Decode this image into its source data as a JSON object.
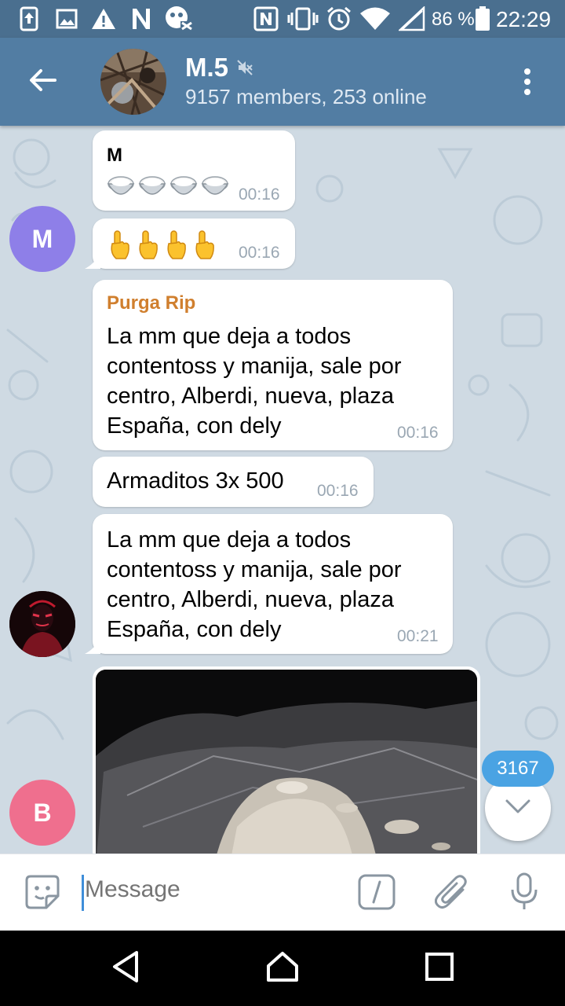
{
  "status_bar": {
    "battery_percent": "86 %",
    "time": "22:29",
    "icons": [
      "upload-icon",
      "image-icon",
      "warning-icon",
      "n-icon",
      "maps-icon",
      "nfc-icon",
      "vibrate-icon",
      "alarm-icon",
      "wifi-icon",
      "signal-icon",
      "battery-icon"
    ]
  },
  "header": {
    "title": "M.5",
    "subtitle": "9157 members, 253 online",
    "icons": [
      "back-arrow-icon",
      "muted-icon",
      "more-vertical-icon"
    ]
  },
  "messages": [
    {
      "sender": "M",
      "sender_color": "#3a8ad8",
      "content": "🍚🍚🍚🍚",
      "emoji_name": "rice-bowl",
      "time": "00:16"
    },
    {
      "content": "👆👆👆👆",
      "emoji_name": "pointing-up",
      "time": "00:16",
      "avatar_letter": "M",
      "avatar_color": "#8e7fe8"
    },
    {
      "sender": "Purga Rip",
      "sender_color": "#d07f2e",
      "lines": [
        "La mm que deja a todos",
        "contentoss y manija, sale por",
        "centro, Alberdi, nueva, plaza",
        "España, con dely"
      ],
      "time": "00:16"
    },
    {
      "text": "Armaditos 3x 500",
      "time": "00:16"
    },
    {
      "lines": [
        "La mm que deja a todos",
        "contentoss y manija, sale por",
        "centro, Alberdi, nueva, plaza",
        "España, con dely"
      ],
      "time": "00:21"
    }
  ],
  "photo_message": {
    "avatar_letter": "B",
    "avatar_color": "#ef6f8e"
  },
  "unread_count": "3167",
  "input": {
    "placeholder": "Message"
  },
  "colors": {
    "header": "#527da3",
    "status_bar": "#4a6f8f",
    "chat_bg": "#cfdae3",
    "accent": "#4aa3e3"
  }
}
